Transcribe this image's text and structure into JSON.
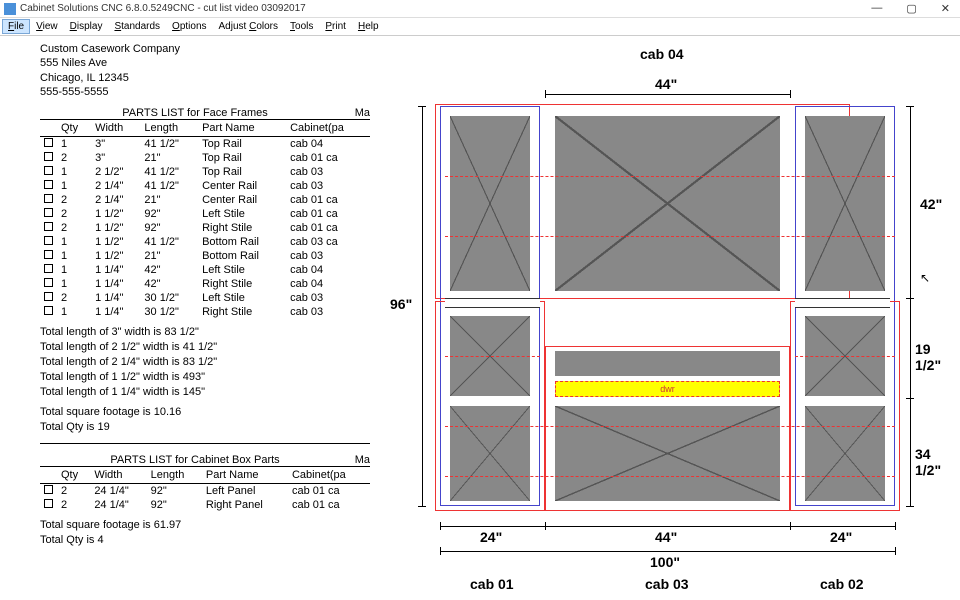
{
  "window": {
    "title": "Cabinet Solutions CNC 6.8.0.5249CNC - cut list video 03092017",
    "controls": {
      "min": "—",
      "max": "▢",
      "close": "✕"
    }
  },
  "menu": {
    "file": "File",
    "view": "View",
    "display": "Display",
    "standards": "Standards",
    "options": "Options",
    "adjust": "Adjust Colors",
    "tools": "Tools",
    "print": "Print",
    "help": "Help"
  },
  "company": {
    "name": "Custom Casework Company",
    "addr": "555 Niles Ave",
    "city": "Chicago, IL 12345",
    "phone": "555-555-5555"
  },
  "list1": {
    "title": "PARTS LIST for Face Frames",
    "ma": "Ma",
    "cols": {
      "qty": "Qty",
      "width": "Width",
      "length": "Length",
      "part": "Part Name",
      "cab": "Cabinet(pa"
    },
    "rows": [
      {
        "qty": "1",
        "w": "3\"",
        "l": "41 1/2\"",
        "p": "Top Rail",
        "c": "cab 04"
      },
      {
        "qty": "2",
        "w": "3\"",
        "l": "21\"",
        "p": "Top Rail",
        "c": "cab 01 ca"
      },
      {
        "qty": "1",
        "w": "2 1/2\"",
        "l": "41 1/2\"",
        "p": "Top Rail",
        "c": "cab 03"
      },
      {
        "qty": "1",
        "w": "2 1/4\"",
        "l": "41 1/2\"",
        "p": "Center Rail",
        "c": "cab 03"
      },
      {
        "qty": "2",
        "w": "2 1/4\"",
        "l": "21\"",
        "p": "Center Rail",
        "c": "cab 01 ca"
      },
      {
        "qty": "2",
        "w": "1 1/2\"",
        "l": "92\"",
        "p": "Left Stile",
        "c": "cab 01 ca"
      },
      {
        "qty": "2",
        "w": "1 1/2\"",
        "l": "92\"",
        "p": "Right Stile",
        "c": "cab 01 ca"
      },
      {
        "qty": "1",
        "w": "1 1/2\"",
        "l": "41 1/2\"",
        "p": "Bottom Rail",
        "c": "cab 03 ca"
      },
      {
        "qty": "1",
        "w": "1 1/2\"",
        "l": "21\"",
        "p": "Bottom Rail",
        "c": "cab 03"
      },
      {
        "qty": "1",
        "w": "1 1/4\"",
        "l": "42\"",
        "p": "Left Stile",
        "c": "cab 04"
      },
      {
        "qty": "1",
        "w": "1 1/4\"",
        "l": "42\"",
        "p": "Right Stile",
        "c": "cab 04"
      },
      {
        "qty": "2",
        "w": "1 1/4\"",
        "l": "30 1/2\"",
        "p": "Left Stile",
        "c": "cab 03"
      },
      {
        "qty": "1",
        "w": "1 1/4\"",
        "l": "30 1/2\"",
        "p": "Right Stile",
        "c": "cab 03"
      }
    ]
  },
  "totals1": {
    "lines": [
      "Total length of   3\"   width is   83 1/2\"",
      "Total length of   2 1/2\"   width is   41 1/2\"",
      "Total length of   2 1/4\"   width is   83 1/2\"",
      "Total length of   1 1/2\"   width is   493\"",
      "Total length of 1 1/4\" width is 145\""
    ],
    "sq": "Total square footage is 10.16",
    "qty": "Total Qty is 19"
  },
  "list2": {
    "title": "PARTS LIST for Cabinet Box Parts",
    "ma": "Ma",
    "cols": {
      "qty": "Qty",
      "width": "Width",
      "length": "Length",
      "part": "Part Name",
      "cab": "Cabinet(pa"
    },
    "rows": [
      {
        "qty": "2",
        "w": "24 1/4\"",
        "l": "92\"",
        "p": "Left Panel",
        "c": "cab 01 ca"
      },
      {
        "qty": "2",
        "w": "24 1/4\"",
        "l": "92\"",
        "p": "Right Panel",
        "c": "cab 01 ca"
      }
    ]
  },
  "totals2": {
    "sq": "Total square footage is 61.97",
    "qty": "Total Qty is 4"
  },
  "drawing": {
    "top_label": "cab 04",
    "top_dim": "44\"",
    "left_dim": "96\"",
    "right_dims": {
      "d1": "42\"",
      "d2": "19 1/2\"",
      "d3": "34 1/2\""
    },
    "bottom_dims": {
      "d1": "24\"",
      "d2": "44\"",
      "d3": "24\"",
      "total": "100\""
    },
    "bottom_labels": {
      "l1": "cab 01",
      "l2": "cab 03",
      "l3": "cab 02"
    },
    "dwr": "dwr"
  }
}
